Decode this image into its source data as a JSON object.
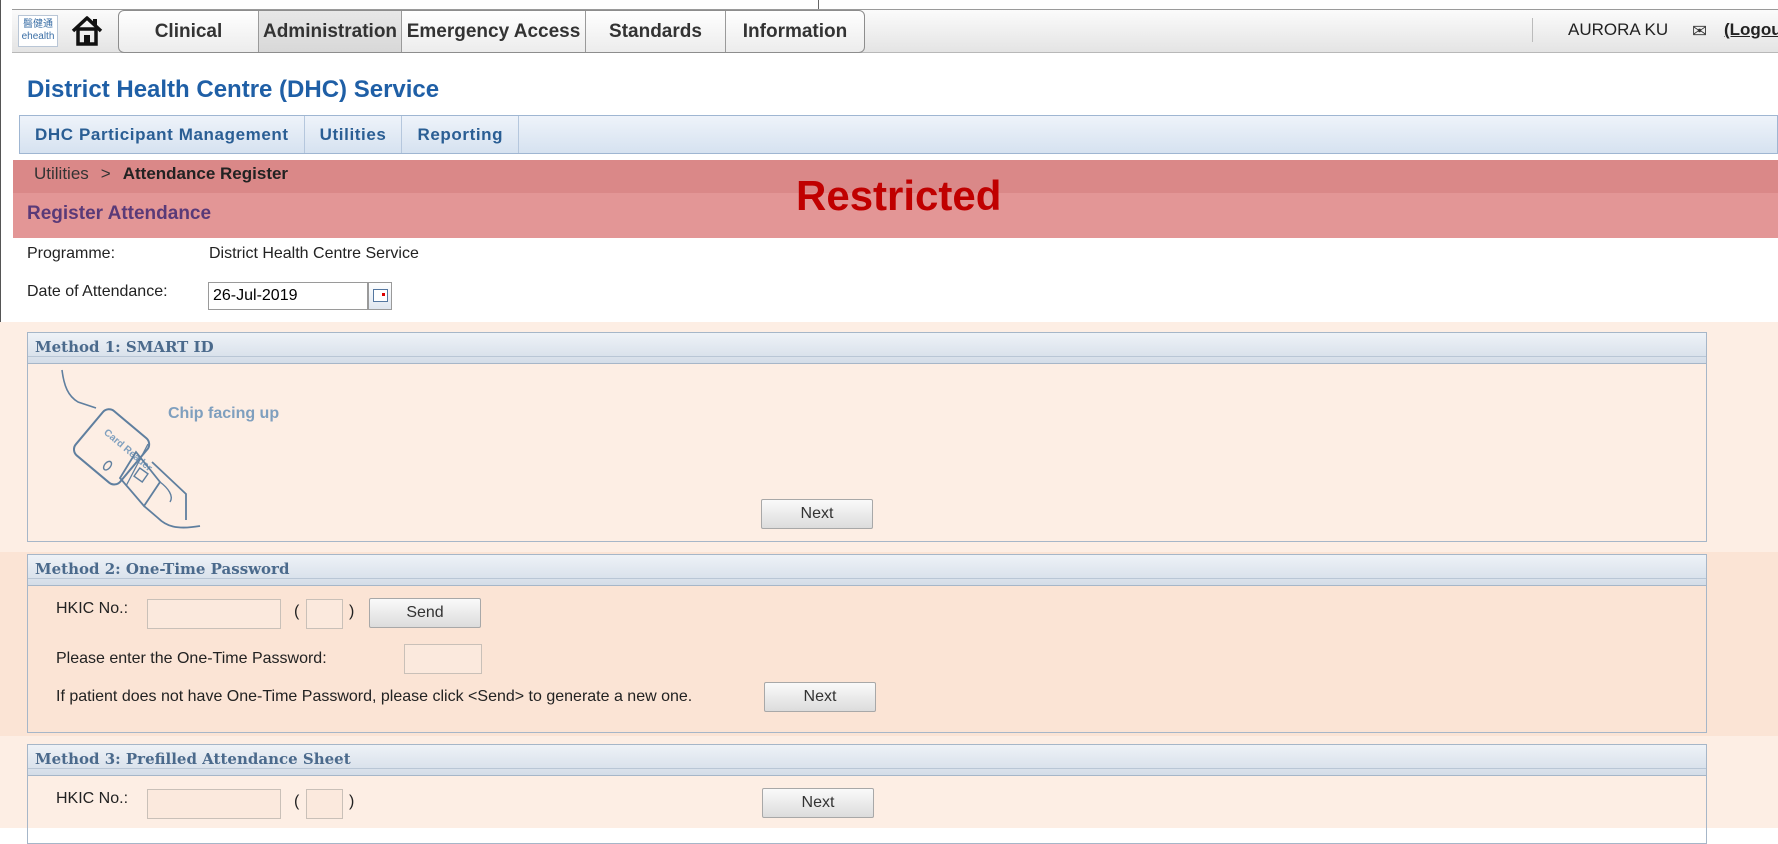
{
  "header": {
    "logo_top": "醫健通",
    "logo_bottom": "ehealth",
    "tabs": [
      {
        "label": "Clinical",
        "width": 140
      },
      {
        "label": "Administration",
        "width": 143
      },
      {
        "label": "Emergency Access",
        "width": 184
      },
      {
        "label": "Standards",
        "width": 140
      },
      {
        "label": "Information",
        "width": 138
      }
    ],
    "user_name": "AURORA KU",
    "logout_label": "(Logout"
  },
  "app_title": "District Health Centre (DHC) Service",
  "subnav": [
    "DHC Participant Management",
    "Utilities",
    "Reporting"
  ],
  "breadcrumb": {
    "parent": "Utilities",
    "separator": ">",
    "current": "Attendance Register"
  },
  "page_title": "Register Attendance",
  "overlay_label": "Restricted",
  "form": {
    "programme_label": "Programme:",
    "programme_value": "District Health Centre Service",
    "date_label": "Date of Attendance:",
    "date_value": "26-Jul-2019"
  },
  "method1": {
    "title": "Method 1: SMART ID",
    "illustration_text": "Chip facing up",
    "card_reader_text": "Card Reader",
    "next_label": "Next"
  },
  "method2": {
    "title": "Method 2: One-Time Password",
    "hkic_label": "HKIC No.:",
    "open_paren": "(",
    "close_paren": ")",
    "send_label": "Send",
    "otp_label": "Please enter the One-Time Password:",
    "hint": "If patient does not have One-Time Password, please click <Send> to generate a new one.",
    "next_label": "Next"
  },
  "method3": {
    "title": "Method 3: Prefilled Attendance Sheet",
    "hkic_label": "HKIC No.:",
    "open_paren": "(",
    "close_paren": ")",
    "next_label": "Next"
  }
}
